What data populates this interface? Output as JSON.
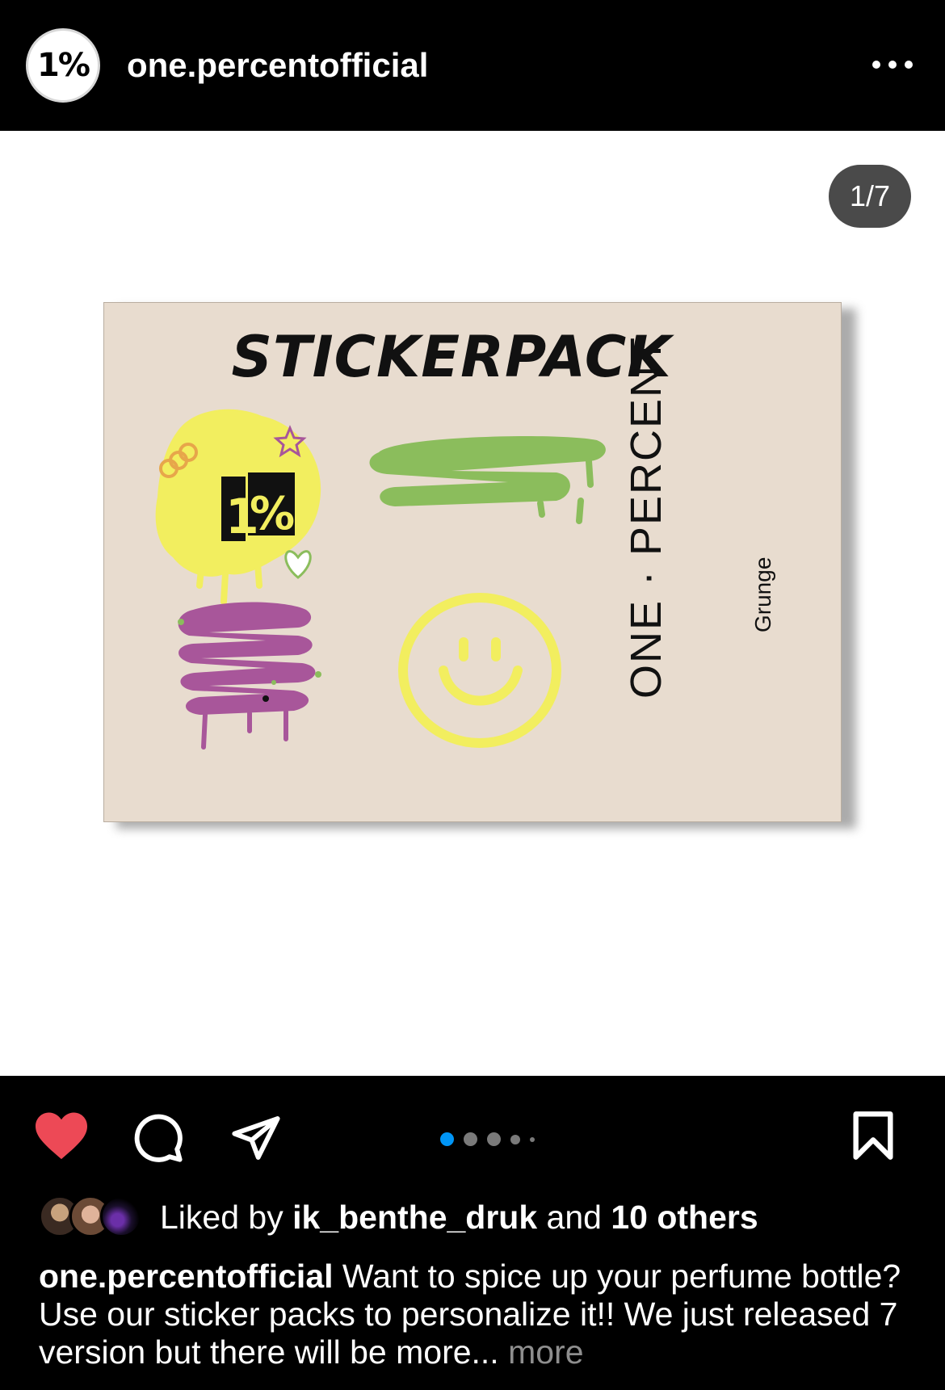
{
  "header": {
    "avatar_text": "1%",
    "username": "one.percentofficial",
    "more_icon": "more-horizontal-icon"
  },
  "media": {
    "counter": "1/7",
    "card": {
      "title": "STICKERPACK",
      "brand": "ONE · PERCENT",
      "subtitle": "Grunge",
      "sticker_badge_text": "1%"
    },
    "colors": {
      "card_bg": "#e8dccf",
      "yellow": "#f2ee5f",
      "green": "#8bbd5c",
      "purple": "#a8569a"
    }
  },
  "actions": {
    "like_icon": "heart-filled-icon",
    "comment_icon": "comment-icon",
    "share_icon": "share-icon",
    "save_icon": "bookmark-icon",
    "carousel_dots": 5,
    "carousel_active_index": 0,
    "like_color": "#ed4956",
    "active_dot_color": "#0095f6"
  },
  "likes": {
    "prefix": "Liked by ",
    "user": "ik_benthe_druk",
    "middle": " and ",
    "others": "10 others"
  },
  "caption": {
    "username": "one.percentofficial",
    "text": " Want to spice up your perfume bottle? Use our sticker packs to personalize it!! We just released 7 version but there will be more...",
    "more": " more"
  }
}
